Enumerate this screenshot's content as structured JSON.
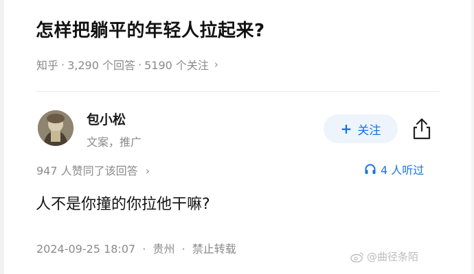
{
  "question": {
    "title": "怎样把躺平的年轻人拉起来?",
    "source": "知乎",
    "answers_count": "3,290 个回答",
    "followers_count": "5190 个关注",
    "separator": "·",
    "chevron": "›"
  },
  "author": {
    "name": "包小松",
    "tag": "文案，推广",
    "follow_label": "关注",
    "follow_plus": "+"
  },
  "answer": {
    "upvote_text": "947 人赞同了该回答",
    "upvote_chevron": "›",
    "listen_text": "4 人听过",
    "content": "人不是你撞的你拉他干嘛?",
    "date": "2024-09-25 18:07",
    "location": "贵州",
    "copyright": "禁止转载",
    "separator": "·"
  },
  "watermark": {
    "text": "@曲径条陌"
  },
  "colors": {
    "accent": "#1772e8",
    "follow_bg": "#eef4fb",
    "meta_gray": "#8a8a8a",
    "title": "#121212"
  },
  "icons": {
    "share": "share-icon",
    "headphones": "headphones-icon",
    "weibo": "weibo-icon"
  }
}
